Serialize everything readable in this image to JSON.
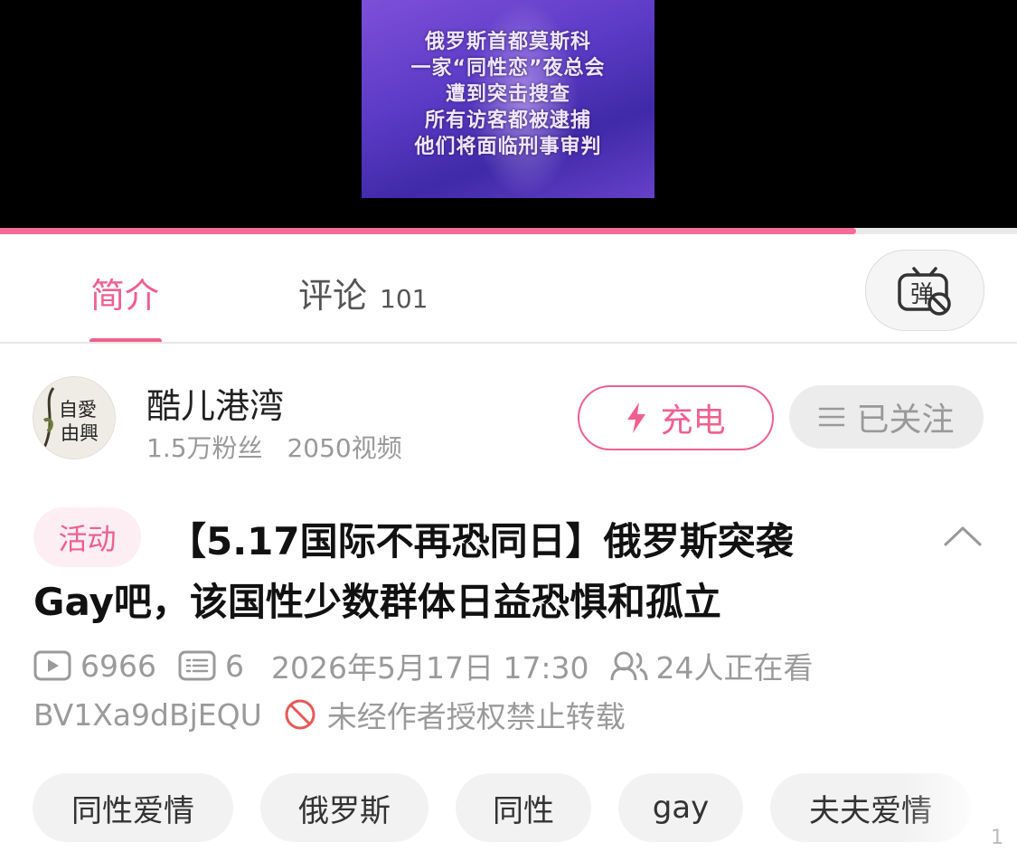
{
  "video": {
    "overlay_lines": [
      "俄罗斯首都莫斯科",
      "一家“同性恋”夜总会",
      "遭到突击搜查",
      "所有访客都被逮捕",
      "他们将面临刑事审判"
    ],
    "progress": 0.842,
    "accent_color": "#f66c99"
  },
  "tabs": {
    "intro_label": "简介",
    "comments_label": "评论",
    "comments_count": "101",
    "danmaku_icon": "danmaku-off-icon"
  },
  "uploader": {
    "avatar_text_1": "自愛",
    "avatar_text_2": "由興",
    "name": "酷儿港湾",
    "followers": "1.5万粉丝",
    "videos": "2050视频",
    "charge_label": "充电",
    "follow_label": "已关注"
  },
  "video_info": {
    "badge": "活动",
    "title_line1": "【5.17国际不再恐同日】俄罗斯突袭",
    "title_line2": "Gay吧，该国性少数群体日益恐惧和孤立",
    "play_count": "6966",
    "danmaku_count": "6",
    "publish_time": "2026年5月17日 17:30",
    "watching": "24人正在看",
    "bvid": "BV1Xa9dBjEQU",
    "copyright_notice": "未经作者授权禁止转载"
  },
  "tags": [
    "同性爱情",
    "俄罗斯",
    "同性",
    "gay",
    "夫夫爱情"
  ],
  "corner_text": "1"
}
